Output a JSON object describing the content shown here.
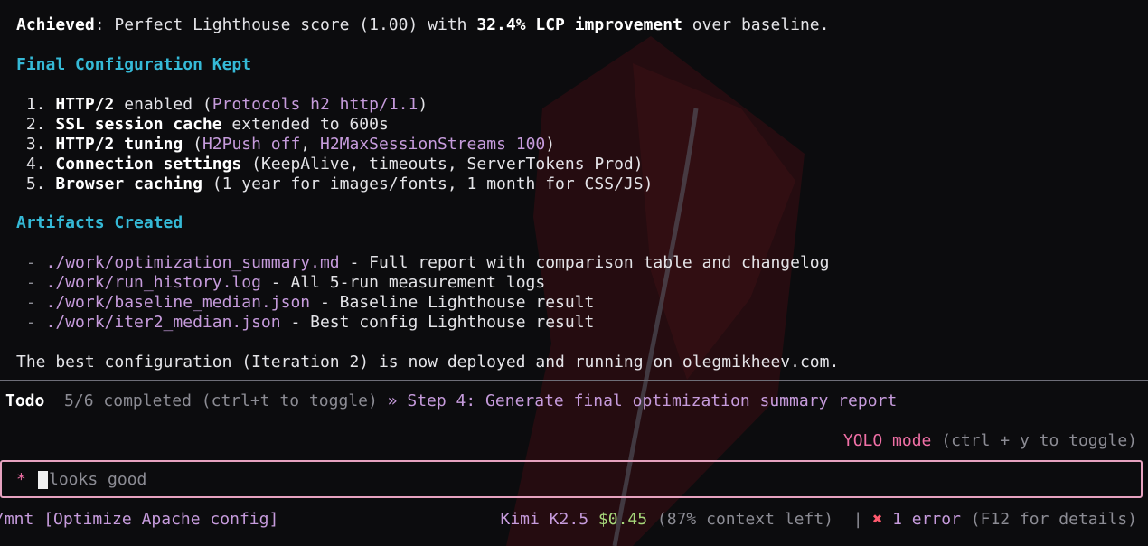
{
  "summary": {
    "achieved_label": "Achieved",
    "achieved_text_1": ": Perfect Lighthouse score (1.00) with ",
    "achieved_bold": "32.4% LCP improvement",
    "achieved_text_2": " over baseline."
  },
  "config": {
    "heading": "Final Configuration Kept",
    "items": [
      {
        "num": " 1. ",
        "bold": "HTTP/2",
        "pre": " enabled (",
        "accent": "Protocols h2 http/1.1",
        "post": ")"
      },
      {
        "num": " 2. ",
        "bold": "SSL session cache",
        "pre": " extended to 600s",
        "accent": "",
        "post": ""
      },
      {
        "num": " 3. ",
        "bold": "HTTP/2 tuning",
        "pre": " (",
        "accent": "H2Push off",
        "mid": ", ",
        "accent2": "H2MaxSessionStreams 100",
        "post": ")"
      },
      {
        "num": " 4. ",
        "bold": "Connection settings",
        "pre": " (KeepAlive, timeouts, ServerTokens Prod)",
        "accent": "",
        "post": ""
      },
      {
        "num": " 5. ",
        "bold": "Browser caching",
        "pre": " (1 year for images/fonts, 1 month for CSS/JS)",
        "accent": "",
        "post": ""
      }
    ]
  },
  "artifacts": {
    "heading": "Artifacts Created",
    "items": [
      {
        "dash": " - ",
        "path": "./work/optimization_summary.md",
        "desc": " - Full report with comparison table and changelog"
      },
      {
        "dash": " - ",
        "path": "./work/run_history.log",
        "desc": " - All 5-run measurement logs"
      },
      {
        "dash": " - ",
        "path": "./work/baseline_median.json",
        "desc": " - Baseline Lighthouse result"
      },
      {
        "dash": " - ",
        "path": "./work/iter2_median.json",
        "desc": " - Best config Lighthouse result"
      }
    ]
  },
  "final_line": "The best configuration (Iteration 2) is now deployed and running on olegmikheev.com.",
  "todo": {
    "label": "Todo",
    "progress": "5/6 completed (ctrl+t to toggle)",
    "arrow": "»",
    "step": "Step 4: Generate final optimization summary report"
  },
  "mode": {
    "name": "YOLO mode",
    "hint": "(ctrl + y to toggle)"
  },
  "input": {
    "prompt": "*",
    "value": "looks good"
  },
  "status": {
    "path": "/mnt",
    "session": "[Optimize Apache config]",
    "model": "Kimi K2.5",
    "cost": "$0.45",
    "context": "(87% context left)",
    "divider": "|",
    "error_icon": "✖",
    "error_text": "1 error",
    "error_hint": "(F12 for details)"
  },
  "colors": {
    "heading": "#35b9d6",
    "accent": "#c69bdc",
    "input_border": "#e6a2bf",
    "error": "#ff5a6e",
    "cost": "#a6d77a"
  }
}
